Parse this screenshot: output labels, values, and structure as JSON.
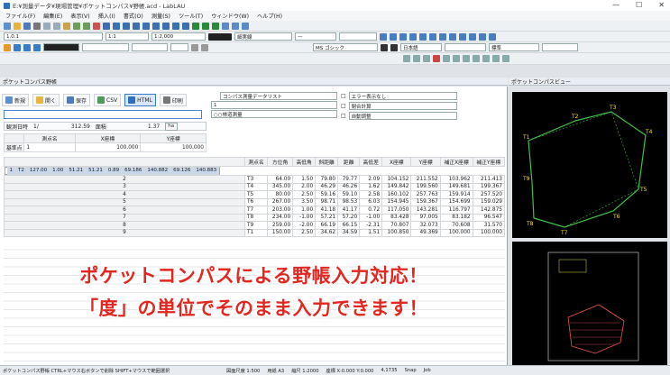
{
  "window": {
    "title": "E:¥測量データ¥現場管理¥ポケットコンパス¥野帳.acd - LabLAU",
    "controls": [
      "—",
      "☐",
      "✕"
    ]
  },
  "menu": [
    "ファイル(F)",
    "編集(E)",
    "表示(V)",
    "挿入(I)",
    "書式(O)",
    "測量(S)",
    "ツール(T)",
    "ウィンドウ(W)",
    "ヘルプ(H)"
  ],
  "toolbar": {
    "layer_value": "1.0.1",
    "scale_value": "1:1",
    "paper_value": "1:2,000",
    "linetype_a": "細実線",
    "linetype_b": "—",
    "font_value": "MS ゴシック",
    "text_style": "日本語",
    "print_style": "標準"
  },
  "left_pane": {
    "title": "ポケットコンパス野帳",
    "buttons": [
      "新規",
      "開く",
      "保存",
      "CSV",
      "HTML",
      "印刷"
    ],
    "dropdowns": [
      {
        "label": "",
        "value": "コンパス測量データリスト"
      },
      {
        "label": "1",
        "value": "1"
      },
      {
        "label": "",
        "value": "○○林道測量"
      }
    ],
    "right_dropdowns": [
      {
        "prefix": "□",
        "value": "エラー表示なし"
      },
      {
        "prefix": "□",
        "value": "閉合計算"
      },
      {
        "prefix": "□",
        "value": "自動調整"
      }
    ],
    "info_row": {
      "label": "観測日時",
      "date": "1/",
      "distance_label": "312.59",
      "distance_suffix": "面積",
      "ratio": "1.37",
      "unit": "ha"
    },
    "header_grid": {
      "columns": [
        "",
        "測点名",
        "X座標",
        "Y座標"
      ],
      "row": [
        "基準点",
        "1",
        "100.000",
        "100.000"
      ]
    },
    "table": {
      "columns": [
        "",
        "測点名",
        "方位角",
        "高低角",
        "斜距離",
        "距離",
        "高低差",
        "X座標",
        "Y座標",
        "補正X座標",
        "補正Y座標"
      ],
      "rows": [
        [
          "1",
          "T2",
          "127.00",
          "1.00",
          "51.21",
          "51.21",
          "0.89",
          "69.186",
          "140.882",
          "69.126",
          "140.883"
        ],
        [
          "2",
          "T3",
          "64.00",
          "1.50",
          "79.80",
          "79.77",
          "2.09",
          "104.152",
          "211.552",
          "103.962",
          "211.413"
        ],
        [
          "3",
          "T4",
          "345.00",
          "2.00",
          "46.29",
          "46.26",
          "1.62",
          "149.842",
          "199.560",
          "149.681",
          "199.367"
        ],
        [
          "4",
          "T5",
          "80.00",
          "2.50",
          "59.16",
          "59.10",
          "2.58",
          "160.102",
          "257.763",
          "159.914",
          "257.520"
        ],
        [
          "5",
          "T6",
          "267.00",
          "3.50",
          "98.71",
          "98.53",
          "6.03",
          "154.945",
          "159.367",
          "154.699",
          "159.029"
        ],
        [
          "6",
          "T7",
          "203.00",
          "1.00",
          "41.18",
          "41.17",
          "0.72",
          "117.050",
          "143.281",
          "116.797",
          "142.875"
        ],
        [
          "7",
          "T8",
          "234.00",
          "-1.00",
          "57.21",
          "57.20",
          "-1.00",
          "83.428",
          "97.005",
          "83.182",
          "96.547"
        ],
        [
          "8",
          "T9",
          "259.00",
          "-2.00",
          "66.19",
          "66.15",
          "-2.31",
          "70.807",
          "32.073",
          "70.608",
          "31.570"
        ],
        [
          "9",
          "T1",
          "150.00",
          "2.50",
          "34.62",
          "34.59",
          "1.51",
          "100.850",
          "49.369",
          "100.000",
          "100.000"
        ]
      ]
    }
  },
  "right_pane": {
    "title": "ポケットコンパスビュー",
    "points": [
      "T1",
      "T2",
      "T3",
      "T4",
      "T5",
      "T6",
      "T7",
      "T8",
      "T9"
    ]
  },
  "overlay": {
    "line1": "ポケットコンパスによる野帳入力対応！",
    "line2": "「度」の単位でそのまま入力できます！"
  },
  "status": {
    "hint": "ポケットコンパス野帳 CTRL+マウス右ボタンで削除 SHIFT+マウスで範囲選択",
    "items": [
      "図面尺度 1:500",
      "用紙 A3",
      "縮尺 1:2000",
      "座標 X:0.000 Y:0.000",
      "4,1735",
      "Snap",
      "Job"
    ]
  },
  "colors": {
    "overlay_text": "#e3261f",
    "survey_line": "#3fc04a",
    "survey_label": "#f0e020",
    "canvas_bg": "#000000"
  }
}
